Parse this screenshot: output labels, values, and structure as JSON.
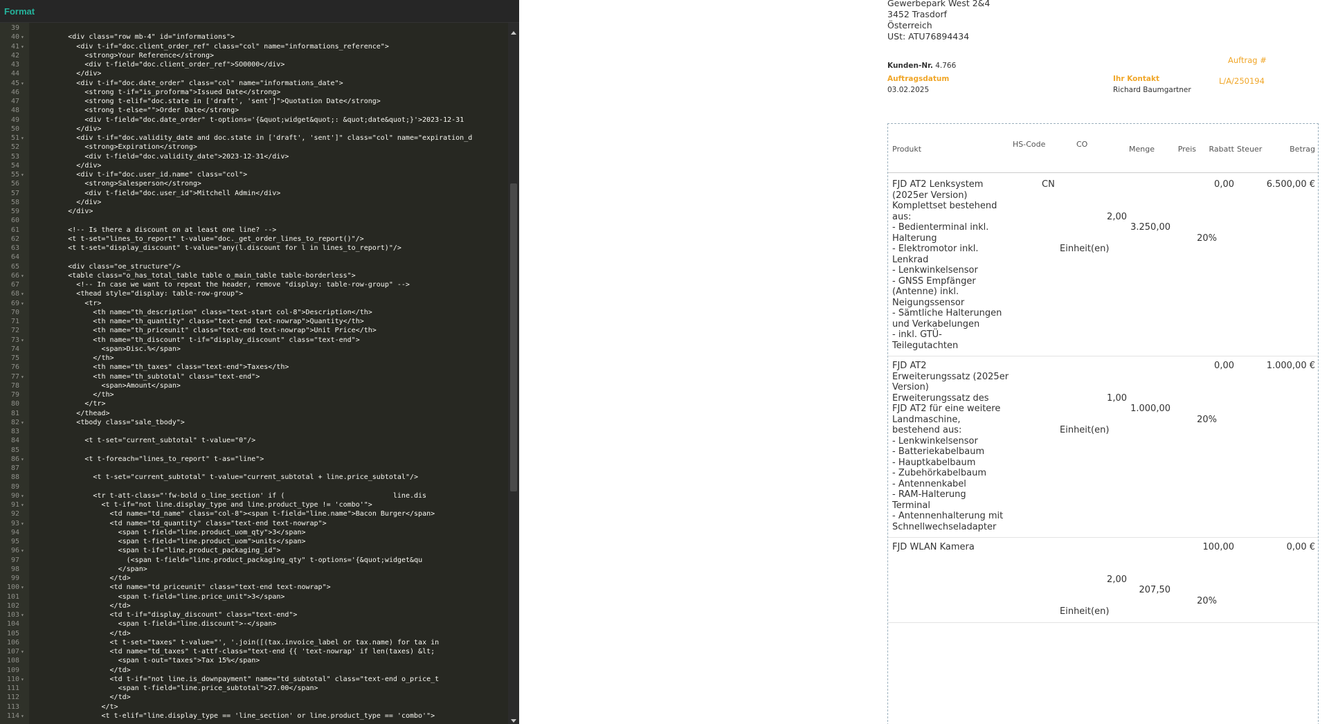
{
  "editor": {
    "toolbar_label": "Format",
    "code": [
      {
        "n": "39",
        "t": ""
      },
      {
        "n": "40",
        "t": "<div class=\"row mb-4\" id=\"informations\">",
        "ind": 8,
        "f": true
      },
      {
        "n": "41",
        "t": "<div t-if=\"doc.client_order_ref\" class=\"col\" name=\"informations_reference\">",
        "ind": 10,
        "f": true
      },
      {
        "n": "42",
        "t": "<strong>Your Reference</strong>",
        "ind": 12
      },
      {
        "n": "43",
        "t": "<div t-field=\"doc.client_order_ref\">SO0000</div>",
        "ind": 12
      },
      {
        "n": "44",
        "t": "</div>",
        "ind": 10
      },
      {
        "n": "45",
        "t": "<div t-if=\"doc.date_order\" class=\"col\" name=\"informations_date\">",
        "ind": 10,
        "f": true
      },
      {
        "n": "46",
        "t": "<strong t-if=\"is_proforma\">Issued Date</strong>",
        "ind": 12
      },
      {
        "n": "47",
        "t": "<strong t-elif=\"doc.state in ['draft', 'sent']\">Quotation Date</strong>",
        "ind": 12
      },
      {
        "n": "48",
        "t": "<strong t-else=\"\">Order Date</strong>",
        "ind": 12
      },
      {
        "n": "49",
        "t": "<div t-field=\"doc.date_order\" t-options='{&quot;widget&quot;: &quot;date&quot;}'>2023-12-31",
        "ind": 12
      },
      {
        "n": "50",
        "t": "</div>",
        "ind": 10
      },
      {
        "n": "51",
        "t": "<div t-if=\"doc.validity_date and doc.state in ['draft', 'sent']\" class=\"col\" name=\"expiration_d",
        "ind": 10,
        "f": true
      },
      {
        "n": "52",
        "t": "<strong>Expiration</strong>",
        "ind": 12
      },
      {
        "n": "53",
        "t": "<div t-field=\"doc.validity_date\">2023-12-31</div>",
        "ind": 12
      },
      {
        "n": "54",
        "t": "</div>",
        "ind": 10
      },
      {
        "n": "55",
        "t": "<div t-if=\"doc.user_id.name\" class=\"col\">",
        "ind": 10,
        "f": true
      },
      {
        "n": "56",
        "t": "<strong>Salesperson</strong>",
        "ind": 12
      },
      {
        "n": "57",
        "t": "<div t-field=\"doc.user_id\">Mitchell Admin</div>",
        "ind": 12
      },
      {
        "n": "58",
        "t": "</div>",
        "ind": 10
      },
      {
        "n": "59",
        "t": "</div>",
        "ind": 8
      },
      {
        "n": "60",
        "t": ""
      },
      {
        "n": "61",
        "t": "<!-- Is there a discount on at least one line? -->",
        "ind": 8
      },
      {
        "n": "62",
        "t": "<t t-set=\"lines_to_report\" t-value=\"doc._get_order_lines_to_report()\"/>",
        "ind": 8
      },
      {
        "n": "63",
        "t": "<t t-set=\"display_discount\" t-value=\"any(l.discount for l in lines_to_report)\"/>",
        "ind": 8
      },
      {
        "n": "64",
        "t": ""
      },
      {
        "n": "65",
        "t": "<div class=\"oe_structure\"/>",
        "ind": 8
      },
      {
        "n": "66",
        "t": "<table class=\"o_has_total_table table o_main_table table-borderless\">",
        "ind": 8,
        "f": true
      },
      {
        "n": "67",
        "t": "<!-- In case we want to repeat the header, remove \"display: table-row-group\" -->",
        "ind": 10
      },
      {
        "n": "68",
        "t": "<thead style=\"display: table-row-group\">",
        "ind": 10,
        "f": true
      },
      {
        "n": "69",
        "t": "<tr>",
        "ind": 12,
        "f": true
      },
      {
        "n": "70",
        "t": "<th name=\"th_description\" class=\"text-start col-8\">Description</th>",
        "ind": 14,
        "hl": true
      },
      {
        "n": "71",
        "t": "<th name=\"th_quantity\" class=\"text-end text-nowrap\">Quantity</th>",
        "ind": 14
      },
      {
        "n": "72",
        "t": "<th name=\"th_priceunit\" class=\"text-end text-nowrap\">Unit Price</th>",
        "ind": 14
      },
      {
        "n": "73",
        "t": "<th name=\"th_discount\" t-if=\"display_discount\" class=\"text-end\">",
        "ind": 14,
        "f": true
      },
      {
        "n": "74",
        "t": "<span>Disc.%</span>",
        "ind": 16
      },
      {
        "n": "75",
        "t": "</th>",
        "ind": 14
      },
      {
        "n": "76",
        "t": "<th name=\"th_taxes\" class=\"text-end\">Taxes</th>",
        "ind": 14
      },
      {
        "n": "77",
        "t": "<th name=\"th_subtotal\" class=\"text-end\">",
        "ind": 14,
        "f": true
      },
      {
        "n": "78",
        "t": "<span>Amount</span>",
        "ind": 16
      },
      {
        "n": "79",
        "t": "</th>",
        "ind": 14
      },
      {
        "n": "80",
        "t": "</tr>",
        "ind": 12
      },
      {
        "n": "81",
        "t": "</thead>",
        "ind": 10
      },
      {
        "n": "82",
        "t": "<tbody class=\"sale_tbody\">",
        "ind": 10,
        "f": true
      },
      {
        "n": "83",
        "t": ""
      },
      {
        "n": "84",
        "t": "<t t-set=\"current_subtotal\" t-value=\"0\"/>",
        "ind": 12
      },
      {
        "n": "85",
        "t": ""
      },
      {
        "n": "86",
        "t": "<t t-foreach=\"lines_to_report\" t-as=\"line\">",
        "ind": 12,
        "f": true
      },
      {
        "n": "87",
        "t": ""
      },
      {
        "n": "88",
        "t": "<t t-set=\"current_subtotal\" t-value=\"current_subtotal + line.price_subtotal\"/>",
        "ind": 14
      },
      {
        "n": "89",
        "t": ""
      },
      {
        "n": "90",
        "t": "<tr t-att-class=\"'fw-bold o_line_section' if (                          line.dis",
        "ind": 14,
        "f": true
      },
      {
        "n": "91",
        "t": "<t t-if=\"not line.display_type and line.product_type != 'combo'\">",
        "ind": 16,
        "f": true
      },
      {
        "n": "92",
        "t": "<td name=\"td_name\" class=\"col-8\"><span t-field=\"line.name\">Bacon Burger</span>",
        "ind": 18
      },
      {
        "n": "93",
        "t": "<td name=\"td_quantity\" class=\"text-end text-nowrap\">",
        "ind": 18,
        "f": true
      },
      {
        "n": "94",
        "t": "<span t-field=\"line.product_uom_qty\">3</span>",
        "ind": 20
      },
      {
        "n": "95",
        "t": "<span t-field=\"line.product_uom\">units</span>",
        "ind": 20
      },
      {
        "n": "96",
        "t": "<span t-if=\"line.product_packaging_id\">",
        "ind": 20,
        "f": true
      },
      {
        "n": "97",
        "t": "(<span t-field=\"line.product_packaging_qty\" t-options='{&quot;widget&qu",
        "ind": 22
      },
      {
        "n": "98",
        "t": "</span>",
        "ind": 20
      },
      {
        "n": "99",
        "t": "</td>",
        "ind": 18
      },
      {
        "n": "100",
        "t": "<td name=\"td_priceunit\" class=\"text-end text-nowrap\">",
        "ind": 18,
        "f": true
      },
      {
        "n": "101",
        "t": "<span t-field=\"line.price_unit\">3</span>",
        "ind": 20
      },
      {
        "n": "102",
        "t": "</td>",
        "ind": 18
      },
      {
        "n": "103",
        "t": "<td t-if=\"display_discount\" class=\"text-end\">",
        "ind": 18,
        "f": true
      },
      {
        "n": "104",
        "t": "<span t-field=\"line.discount\">-</span>",
        "ind": 20
      },
      {
        "n": "105",
        "t": "</td>",
        "ind": 18
      },
      {
        "n": "106",
        "t": "<t t-set=\"taxes\" t-value=\"', '.join([(tax.invoice_label or tax.name) for tax in",
        "ind": 18
      },
      {
        "n": "107",
        "t": "<td name=\"td_taxes\" t-attf-class=\"text-end {{ 'text-nowrap' if len(taxes) &lt;",
        "ind": 18,
        "f": true
      },
      {
        "n": "108",
        "t": "<span t-out=\"taxes\">Tax 15%</span>",
        "ind": 20
      },
      {
        "n": "109",
        "t": "</td>",
        "ind": 18
      },
      {
        "n": "110",
        "t": "<td t-if=\"not line.is_downpayment\" name=\"td_subtotal\" class=\"text-end o_price_t",
        "ind": 18,
        "f": true
      },
      {
        "n": "111",
        "t": "<span t-field=\"line.price_subtotal\">27.00</span>",
        "ind": 20
      },
      {
        "n": "112",
        "t": "</td>",
        "ind": 18
      },
      {
        "n": "113",
        "t": "</t>",
        "ind": 16
      },
      {
        "n": "114",
        "t": "<t t-elif=\"line.display_type == 'line_section' or line.product_type == 'combo'\">",
        "ind": 16,
        "f": true
      }
    ]
  },
  "document": {
    "address": [
      "Gewerbepark West 2&4",
      "3452 Trasdorf",
      "Österreich",
      "USt: ATU76894434"
    ],
    "customer_no_label": "Kunden-Nr.",
    "customer_no": "4.766",
    "order_no_label": "Auftrag #",
    "order_date_label": "Auftragsdatum",
    "order_date": "03.02.2025",
    "contact_label": "Ihr Kontakt",
    "contact_name": "Richard Baumgartner",
    "order_ref": "L/A/250194",
    "headers": {
      "product": "Produkt",
      "hs_code": "HS-Code",
      "co": "CO",
      "quantity": "Menge",
      "price": "Preis",
      "discount": "Rabatt",
      "tax": "Steuer",
      "amount": "Betrag"
    },
    "lines": [
      {
        "description": [
          "FJD AT2 Lenksystem",
          "(2025er Version)",
          "Komplettset bestehend",
          "aus:",
          "- Bedienterminal inkl.",
          "Halterung",
          "- Elektromotor inkl.",
          "Lenkrad",
          "- Lenkwinkelsensor",
          "- GNSS Empfänger",
          "(Antenne) inkl.",
          "Neigungssensor",
          "- Sämtliche Halterungen",
          "und Verkabelungen",
          "- inkl. GTÜ-",
          "Teilegutachten"
        ],
        "co": "CN",
        "quantity": "2,00",
        "uom": "Einheit(en)",
        "price": "3.250,00",
        "discount": "0,00",
        "tax": "20%",
        "amount": "6.500,00 €"
      },
      {
        "description": [
          "FJD AT2",
          "Erweiterungssatz (2025er",
          "Version)",
          "Erweiterungssatz des",
          "FJD AT2 für eine weitere",
          "Landmaschine,",
          "bestehend aus:",
          "- Lenkwinkelsensor",
          "- Batteriekabelbaum",
          "- Hauptkabelbaum",
          "- Zubehörkabelbaum",
          "- Antennenkabel",
          "- RAM-Halterung",
          "Terminal",
          "- Antennenhalterung mit",
          "Schnellwechseladapter"
        ],
        "co": "",
        "quantity": "1,00",
        "uom": "Einheit(en)",
        "price": "1.000,00",
        "discount": "0,00",
        "tax": "20%",
        "amount": "1.000,00 €"
      },
      {
        "description": [
          "FJD WLAN Kamera"
        ],
        "co": "",
        "quantity": "2,00",
        "uom": "Einheit(en)",
        "price": "207,50",
        "discount": "100,00",
        "tax": "20%",
        "amount": "0,00 €"
      }
    ]
  }
}
